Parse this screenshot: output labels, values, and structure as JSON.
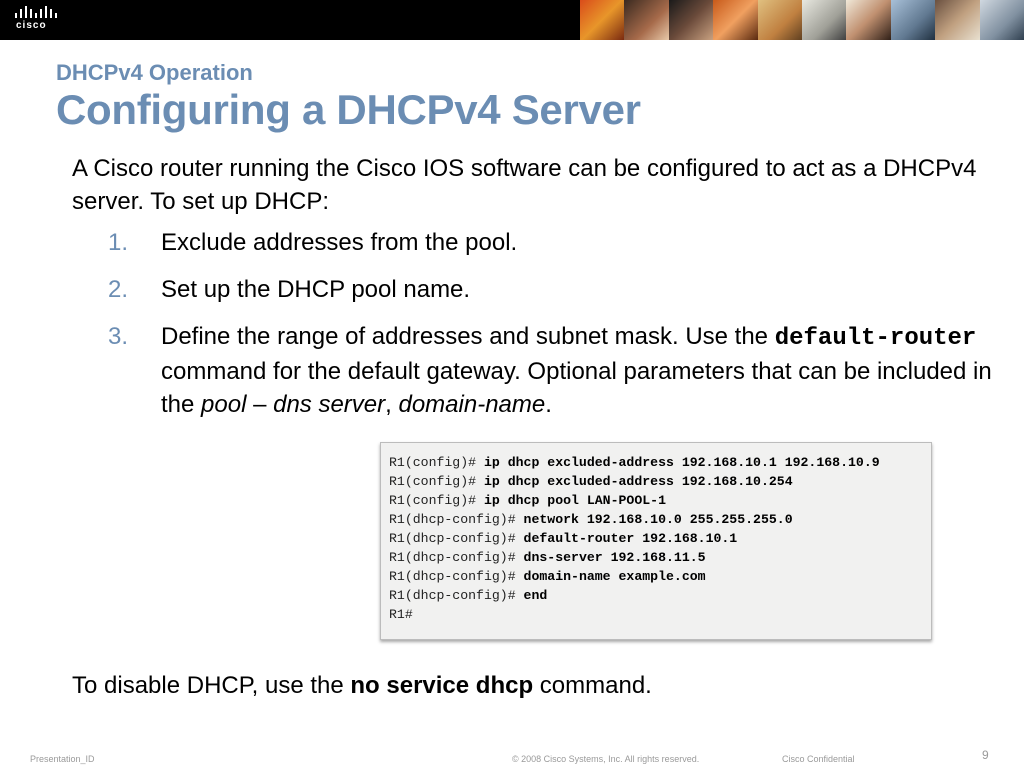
{
  "header": {
    "logo_text": "cisco",
    "photo_strip_icon": "people-photo-collage"
  },
  "slide": {
    "subtitle": "DHCPv4 Operation",
    "title": "Configuring a DHCPv4 Server",
    "intro": "A Cisco router running the Cisco IOS software can be configured to act as a DHCPv4 server. To set up DHCP:",
    "steps": [
      {
        "num": "1.",
        "text": "Exclude addresses from the pool."
      },
      {
        "num": "2.",
        "text": "Set up the DHCP pool name."
      },
      {
        "num": "3.",
        "text_a": "Define the range of addresses and subnet mask. Use the ",
        "code": "default-router",
        "text_b": " command for the default gateway. Optional parameters that can be included in the ",
        "ital_a": "pool",
        "text_c": " – ",
        "ital_b": "dns server",
        "text_d": ", ",
        "ital_c": "domain-name",
        "text_e": "."
      }
    ],
    "closing_a": "To disable DHCP, use the ",
    "closing_cmd": "no service dhcp",
    "closing_b": " command."
  },
  "cli": [
    {
      "prompt": "R1(config)# ",
      "cmd": "ip dhcp excluded-address 192.168.10.1 192.168.10.9"
    },
    {
      "prompt": "R1(config)# ",
      "cmd": "ip dhcp excluded-address 192.168.10.254"
    },
    {
      "prompt": "R1(config)# ",
      "cmd": "ip dhcp pool LAN-POOL-1"
    },
    {
      "prompt": "R1(dhcp-config)# ",
      "cmd": "network 192.168.10.0 255.255.255.0"
    },
    {
      "prompt": "R1(dhcp-config)# ",
      "cmd": "default-router 192.168.10.1"
    },
    {
      "prompt": "R1(dhcp-config)# ",
      "cmd": "dns-server 192.168.11.5"
    },
    {
      "prompt": "R1(dhcp-config)# ",
      "cmd": "domain-name example.com"
    },
    {
      "prompt": "R1(dhcp-config)# ",
      "cmd": "end"
    },
    {
      "prompt": "R1#",
      "cmd": ""
    }
  ],
  "footer": {
    "left": "Presentation_ID",
    "copyright": "© 2008 Cisco Systems, Inc. All rights reserved.",
    "confidential": "Cisco Confidential",
    "page": "9"
  },
  "colors": {
    "title_blue": "#6b8db3",
    "header_black": "#000000",
    "footer_gray": "#9a9a9a"
  }
}
